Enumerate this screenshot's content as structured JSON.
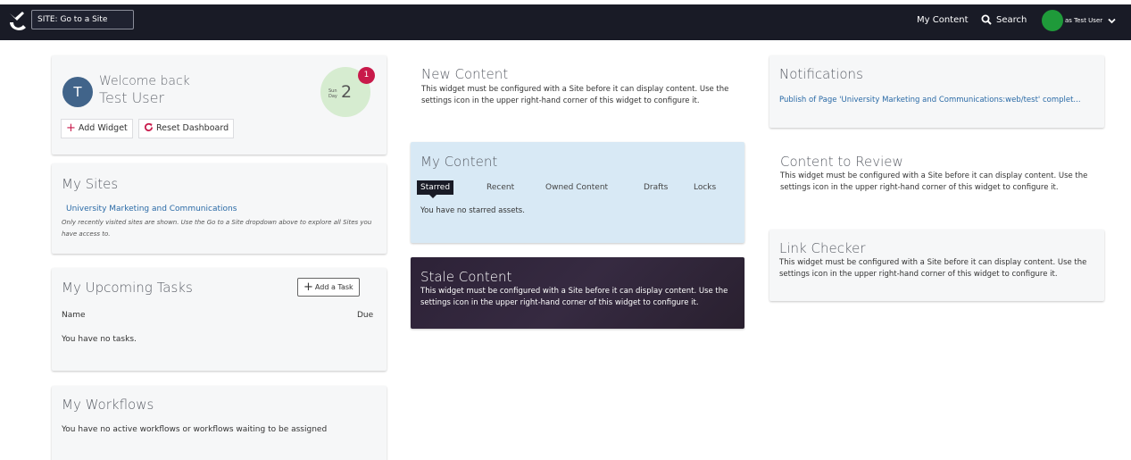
{
  "topbar": {
    "site_label": "SITE:",
    "site_placeholder": "Go to a Site",
    "my_content": "My Content",
    "search": "Search",
    "user": "as Test User",
    "avatar_color": "#1f9a3a",
    "background": "#191b26"
  },
  "welcome": {
    "avatar_initial": "T",
    "greeting": "Welcome back",
    "user_name": "Test User",
    "day_name": "Sun",
    "day_name_2": "Day",
    "day_number": "2",
    "notification_count": "1",
    "add_widget": "Add Widget",
    "reset_dashboard": "Reset Dashboard"
  },
  "my_sites": {
    "title": "My Sites",
    "site_link": "University Marketing and Communications",
    "note": "Only recently visited sites are shown. Use the Go to a Site dropdown above to explore all Sites you have access to."
  },
  "tasks": {
    "title": "My Upcoming Tasks",
    "add_task": "Add a Task",
    "col_name": "Name",
    "col_due": "Due",
    "empty": "You have no tasks."
  },
  "workflows": {
    "title": "My Workflows",
    "empty": "You have no active workflows or workflows waiting to be assigned"
  },
  "new_content": {
    "title": "New Content",
    "message": "This widget must be configured with a Site before it can display content. Use the settings icon in the upper right-hand corner of this widget to configure it."
  },
  "my_content": {
    "title": "My Content",
    "tabs": [
      "Starred",
      "Recent",
      "Owned Content",
      "Drafts",
      "Locks"
    ],
    "active_tab": "Starred",
    "empty": "You have no starred assets."
  },
  "stale_content": {
    "title": "Stale Content",
    "message": "This widget must be configured with a Site before it can display content. Use the settings icon in the upper right-hand corner of this widget to configure it."
  },
  "notifications": {
    "title": "Notifications",
    "item": "Publish of Page 'University Marketing and Communications:web/test' complet..."
  },
  "content_to_review": {
    "title": "Content to Review",
    "message": "This widget must be configured with a Site before it can display content. Use the settings icon in the upper right-hand corner of this widget to configure it."
  },
  "link_checker": {
    "title": "Link Checker",
    "message": "This widget must be configured with a Site before it can display content. Use the settings icon in the upper right-hand corner of this widget to configure it."
  },
  "colors": {
    "accent": "#c8194a",
    "link": "#2a6aa6",
    "my_content_bg": "#d8e9f5",
    "stale_bg": "#2c2235"
  }
}
